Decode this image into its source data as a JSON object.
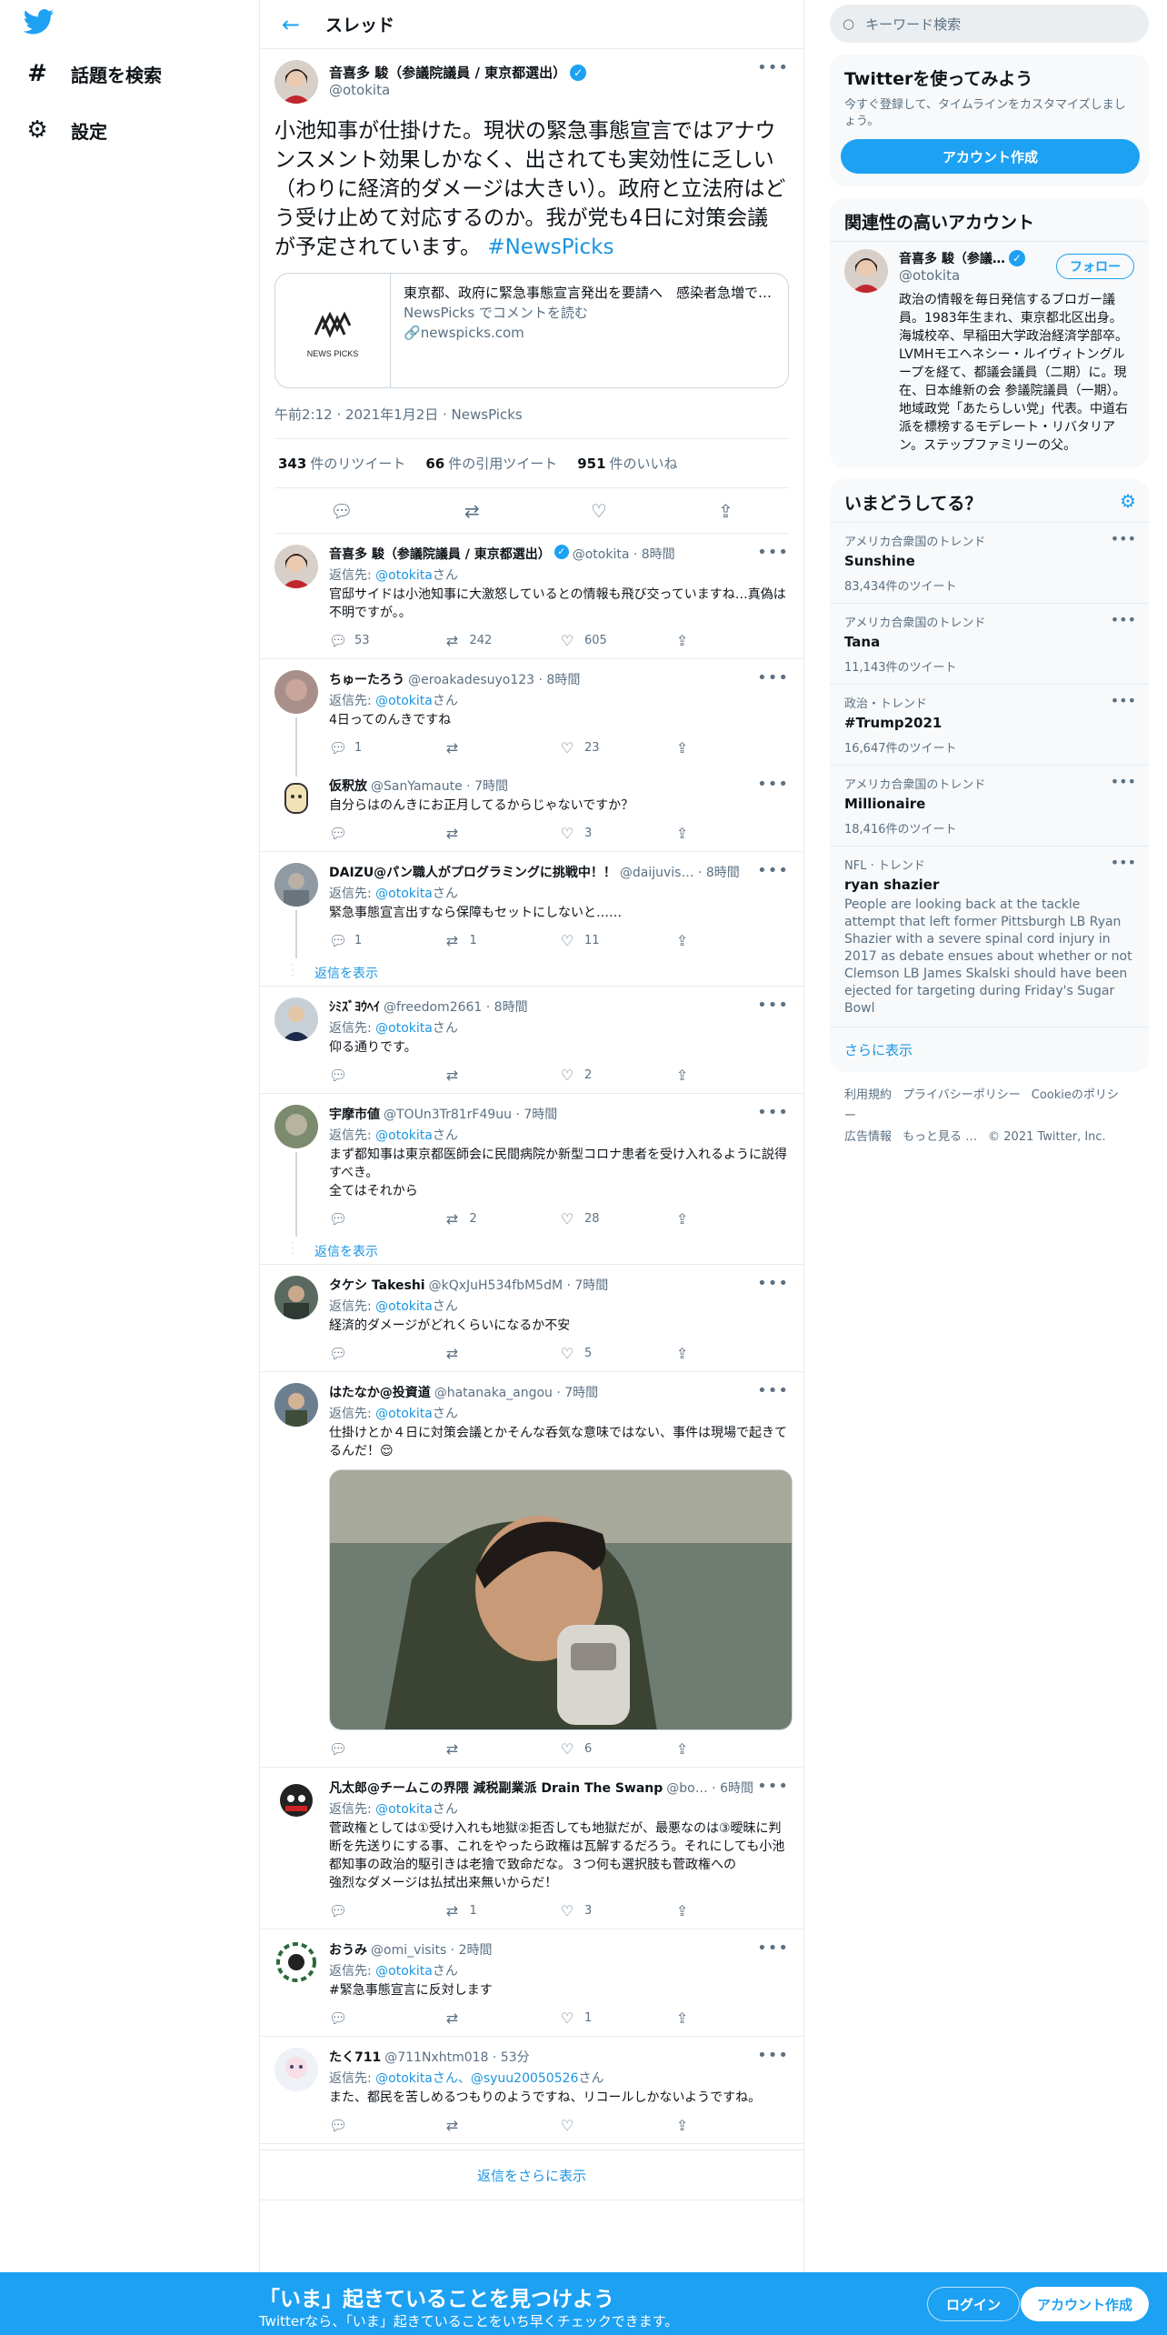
{
  "nav": {
    "explore_label": "話題を検索",
    "settings_label": "設定"
  },
  "header": {
    "title": "スレッド"
  },
  "focus_tweet": {
    "name": "音喜多 駿（参議院議員 / 東京都選出）",
    "handle": "@otokita",
    "text": "小池知事が仕掛けた。現状の緊急事態宣言ではアナウンスメント効果しかなく、出されても実効性に乏しい（わりに経済的ダメージは大きい）。政府と立法府はどう受け止めて対応するのか。我が党も4日に対策会議が予定されています。",
    "hashtag": "#NewsPicks",
    "card_title": "東京都、政府に緊急事態宣言発出を要請へ　感染者急増で (...",
    "card_desc": "NewsPicks でコメントを読む",
    "card_domain": "newspicks.com",
    "card_logo_text": "NEWS PICKS",
    "timestamp": "午前2:12 · 2021年1月2日 · NewsPicks",
    "retweets": "343",
    "retweets_label": "件のリツイート",
    "quotes": "66",
    "quotes_label": "件の引用ツイート",
    "likes": "951",
    "likes_label": "件のいいね"
  },
  "replies": [
    {
      "name": "音喜多 駿（参議院議員 / 東京都選出）",
      "meta": "@otokita · 8時間",
      "to_prefix": "返信先: ",
      "to": "@otokita",
      "to_suffix": "さん",
      "text": "官邸サイドは小池知事に大激怒しているとの情報も飛び交っていますね…真偽は不明ですが。。",
      "replies": "53",
      "retweets": "242",
      "likes": "605"
    },
    {
      "name": "ちゅーたろう",
      "meta": "@eroakadesuyo123 · 8時間",
      "to_prefix": "返信先: ",
      "to": "@otokita",
      "to_suffix": "さん",
      "text": "4日ってのんきですね",
      "replies": "1",
      "retweets": "",
      "likes": "23"
    },
    {
      "name": "仮釈放",
      "meta": "@SanYamaute · 7時間",
      "text": "自分らはのんきにお正月してるからじゃないですか？",
      "replies": "",
      "retweets": "",
      "likes": "3"
    },
    {
      "name": "DAIZU@パン職人がプログラミングに挑戦中！！",
      "meta": "@daijuvis… · 8時間",
      "to_prefix": "返信先: ",
      "to": "@otokita",
      "to_suffix": "さん",
      "text": "緊急事態宣言出すなら保障もセットにしないと……",
      "replies": "1",
      "retweets": "1",
      "likes": "11"
    },
    {
      "name": "ｼﾐｽﾞﾖｳﾍｲ",
      "meta": "@freedom2661 · 8時間",
      "to_prefix": "返信先: ",
      "to": "@otokita",
      "to_suffix": "さん",
      "text": "仰る通りです。",
      "replies": "",
      "retweets": "",
      "likes": "2"
    },
    {
      "name": "宇摩市値",
      "meta": "@TOUn3Tr81rF49uu · 7時間",
      "to_prefix": "返信先: ",
      "to": "@otokita",
      "to_suffix": "さん",
      "text": "まず都知事は東京都医師会に民間病院か新型コロナ患者を受け入れるように説得すべき。\n全てはそれから",
      "replies": "",
      "retweets": "2",
      "likes": "28"
    },
    {
      "name": "タケシ Takeshi",
      "meta": "@kQxJuH534fbM5dM · 7時間",
      "to_prefix": "返信先: ",
      "to": "@otokita",
      "to_suffix": "さん",
      "text": "経済的ダメージがどれくらいになるか不安",
      "replies": "",
      "retweets": "",
      "likes": "5"
    },
    {
      "name": "はたなか@投資道",
      "meta": "@hatanaka_angou · 7時間",
      "to_prefix": "返信先: ",
      "to": "@otokita",
      "to_suffix": "さん",
      "text": "仕掛けとか４日に対策会議とかそんな呑気な意味ではない、事件は現場で起きてるんだ！😌",
      "replies": "",
      "retweets": "",
      "likes": "6"
    },
    {
      "name": "凡太郎@チームこの界隈 減税副業派 Drain The Swanp",
      "meta": "@bo… · 6時間",
      "to_prefix": "返信先: ",
      "to": "@otokita",
      "to_suffix": "さん",
      "text": "菅政権としては①受け入れも地獄②拒否しても地獄だが、最悪なのは③曖昧に判断を先送りにする事、これをやったら政権は瓦解するだろう。それにしても小池都知事の政治的駆引きは老獪で致命だな。３つ何も選択肢も菅政権への\n強烈なダメージは払拭出来無いからだ！",
      "replies": "",
      "retweets": "1",
      "likes": "3"
    },
    {
      "name": "おうみ",
      "meta": "@omi_visits · 2時間",
      "to_prefix": "返信先: ",
      "to": "@otokita",
      "to_suffix": "さん",
      "text": "#緊急事態宣言に反対します",
      "replies": "",
      "retweets": "",
      "likes": "1"
    },
    {
      "name": "たく711",
      "meta": "@711Nxhtm018 · 53分",
      "to_prefix": "返信先: ",
      "to": "@otokitaさん、@syuu20050526",
      "to_suffix": "さん",
      "text": "また、都民を苦しめるつもりのようですね、リコールしかないようですね。",
      "replies": "",
      "retweets": "",
      "likes": ""
    }
  ],
  "show_replies_label": "返信を表示",
  "more_replies_label": "返信をさらに表示",
  "sidebar": {
    "search_placeholder": "キーワード検索",
    "cta_title": "Twitterを使ってみよう",
    "cta_sub": "今すぐ登録して、タイムラインをカスタマイズしましょう。",
    "cta_button": "アカウント作成",
    "relevant_title": "関連性の高いアカウント",
    "acct_name": "音喜多 駿（参議…",
    "acct_handle": "@otokita",
    "follow_label": "フォロー",
    "acct_bio": "政治の情報を毎日発信するブロガー議員。1983年生まれ、東京都北区出身。海城校卒、早稲田大学政治経済学部卒。LVMHモエヘネシー・ルイヴィトングループを経て、都議会議員（二期）に。現在、日本維新の会 参議院議員（一期）。地域政党「あたらしい党」代表。中道右派を標榜するモデレート・リバタリアン。ステップファミリーの父。",
    "trends_title": "いまどうしてる？",
    "trends": [
      {
        "ctx": "アメリカ合衆国のトレンド",
        "name": "Sunshine",
        "count": "83,434件のツイート"
      },
      {
        "ctx": "アメリカ合衆国のトレンド",
        "name": "Tana",
        "count": "11,143件のツイート"
      },
      {
        "ctx": "政治・トレンド",
        "name": "#Trump2021",
        "count": "16,647件のツイート"
      },
      {
        "ctx": "アメリカ合衆国のトレンド",
        "name": "Millionaire",
        "count": "18,416件のツイート"
      },
      {
        "ctx": "NFL · トレンド",
        "name": "ryan shazier",
        "desc": "People are looking back at the tackle attempt that left former Pittsburgh LB Ryan Shazier with a severe spinal cord injury in 2017 as debate ensues about whether or not Clemson LB James Skalski should have been ejected for targeting during Friday's Sugar Bowl"
      }
    ],
    "show_more": "さらに表示",
    "footer": [
      "利用規約",
      "プライバシーポリシー",
      "Cookieのポリシー",
      "広告情報",
      "もっと見る …",
      "© 2021 Twitter, Inc."
    ]
  },
  "bottom_bar": {
    "title": "「いま」起きていることを見つけよう",
    "sub": "Twitterなら、「いま」起きていることをいち早くチェックできます。",
    "login": "ログイン",
    "signup": "アカウント作成"
  },
  "colors": {
    "accent": "#1da1f2",
    "link": "#1b95e0",
    "muted": "#5b7083"
  }
}
